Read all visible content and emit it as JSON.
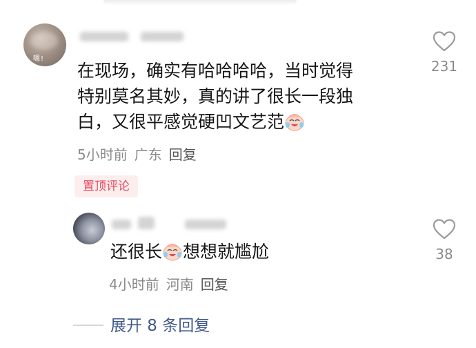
{
  "comment": {
    "text_lines": [
      "在现场，确实有哈哈哈哈，当时觉得",
      "特别莫名其妙，真的讲了很长一段独",
      "白，又很平感觉硬凹文艺范"
    ],
    "time": "5小时前",
    "location": "广东",
    "reply_label": "回复",
    "pinned_label": "置顶评论",
    "like_count": "231",
    "avatar_sticker_text": "嗯!"
  },
  "reply": {
    "text_before": "还很长",
    "text_after": "想想就尴尬",
    "time": "4小时前",
    "location": "河南",
    "reply_label": "回复",
    "like_count": "38"
  },
  "expand": {
    "label": "展开 8 条回复"
  },
  "colors": {
    "pinned_bg": "#fdeeee",
    "pinned_text": "#e5495d",
    "link": "#3f5a8a",
    "meta": "#8a8a8a"
  },
  "icons": {
    "like": "heart-outline-icon",
    "emoji": "crying-laughing-emoji-icon"
  }
}
